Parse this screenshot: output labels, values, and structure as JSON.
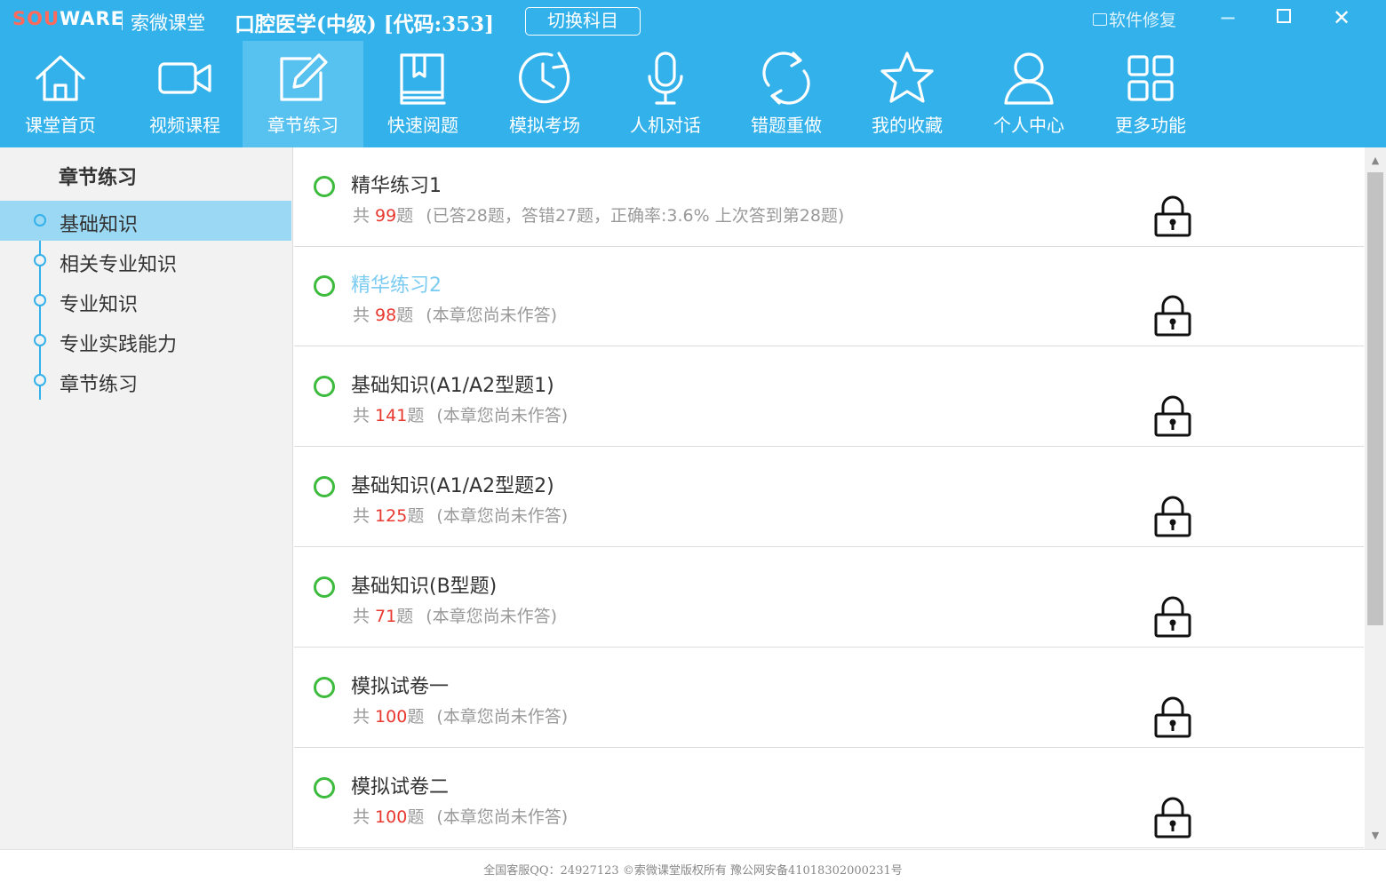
{
  "window": {
    "logo_sou": "SOU",
    "logo_ware": "WARE",
    "brand": "索微课堂",
    "subject": "口腔医学(中级) [代码:353]",
    "switch_label": "切换科目",
    "repair_label": "软件修复",
    "min_glyph": "−",
    "close_glyph": "✕"
  },
  "colors": {
    "accent": "#33b1ea",
    "active_nav": "#57c2f0",
    "side_active": "#9bd8f4",
    "ring_green": "#3dbb3d",
    "count_red": "#e8382f"
  },
  "nav": [
    {
      "label": "课堂首页",
      "icon": "home-icon"
    },
    {
      "label": "视频课程",
      "icon": "video-camera-icon"
    },
    {
      "label": "章节练习",
      "icon": "edit-icon",
      "active": true
    },
    {
      "label": "快速阅题",
      "icon": "book-icon"
    },
    {
      "label": "模拟考场",
      "icon": "clock-icon"
    },
    {
      "label": "人机对话",
      "icon": "microphone-icon"
    },
    {
      "label": "错题重做",
      "icon": "refresh-icon"
    },
    {
      "label": "我的收藏",
      "icon": "star-icon"
    },
    {
      "label": "个人中心",
      "icon": "user-icon"
    },
    {
      "label": "更多功能",
      "icon": "grid-icon"
    }
  ],
  "sidebar": {
    "title": "章节练习",
    "items": [
      {
        "label": "基础知识",
        "active": true
      },
      {
        "label": "相关专业知识"
      },
      {
        "label": "专业知识"
      },
      {
        "label": "专业实践能力"
      },
      {
        "label": "章节练习"
      }
    ]
  },
  "list": {
    "prefix": "共 ",
    "unit": "题",
    "rows": [
      {
        "title": "精华练习1",
        "count": "99",
        "status": "(已答28题，答错27题，正确率:3.6% 上次答到第28题)"
      },
      {
        "title": "精华练习2",
        "count": "98",
        "status": "(本章您尚未作答)",
        "highlight": true
      },
      {
        "title": "基础知识(A1/A2型题1)",
        "count": "141",
        "status": "(本章您尚未作答)"
      },
      {
        "title": "基础知识(A1/A2型题2)",
        "count": "125",
        "status": "(本章您尚未作答)"
      },
      {
        "title": "基础知识(B型题)",
        "count": "71",
        "status": "(本章您尚未作答)"
      },
      {
        "title": "模拟试卷一",
        "count": "100",
        "status": "(本章您尚未作答)"
      },
      {
        "title": "模拟试卷二",
        "count": "100",
        "status": "(本章您尚未作答)"
      }
    ]
  },
  "footer": {
    "text": "全国客服QQ：24927123 ©索微课堂版权所有 豫公网安备41018302000231号"
  }
}
